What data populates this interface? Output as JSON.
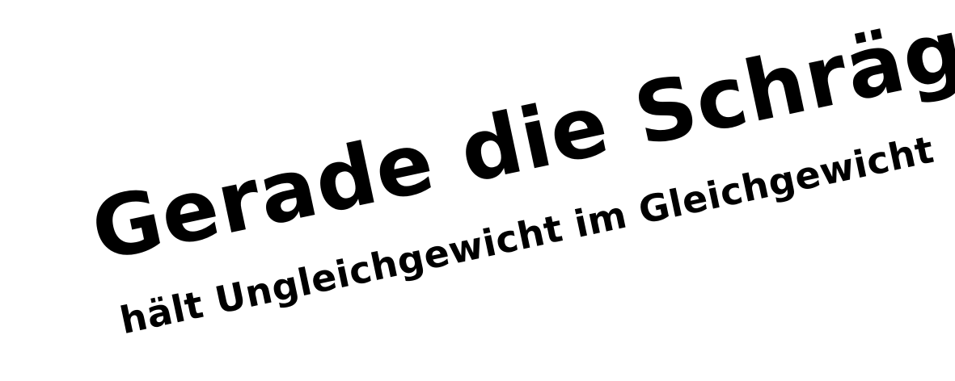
{
  "slogan": {
    "headline": "Gerade die Schräge",
    "subline": "hält Ungleichgewicht im Gleichgewicht",
    "text_color": "#000000",
    "background_color": "#ffffff"
  }
}
